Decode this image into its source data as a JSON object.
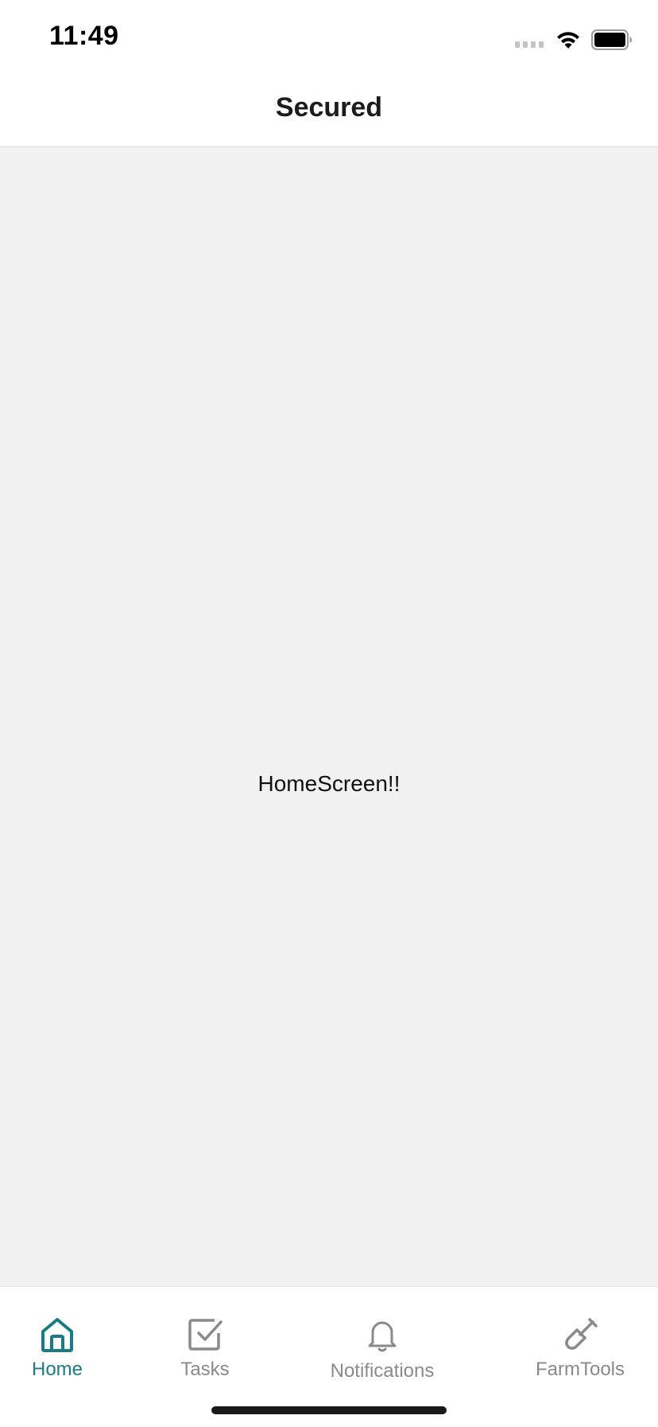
{
  "status_bar": {
    "time": "11:49"
  },
  "header": {
    "title": "Secured"
  },
  "main": {
    "text": "HomeScreen!!"
  },
  "tab_bar": {
    "tabs": [
      {
        "label": "Home",
        "icon": "home-icon",
        "active": true
      },
      {
        "label": "Tasks",
        "icon": "checkbox-icon",
        "active": false
      },
      {
        "label": "Notifications",
        "icon": "bell-icon",
        "active": false
      },
      {
        "label": "FarmTools",
        "icon": "shovel-icon",
        "active": false
      }
    ]
  },
  "colors": {
    "accent": "#1b7b85",
    "inactive": "#8a8a8a",
    "content_background": "#f1f1f1"
  }
}
